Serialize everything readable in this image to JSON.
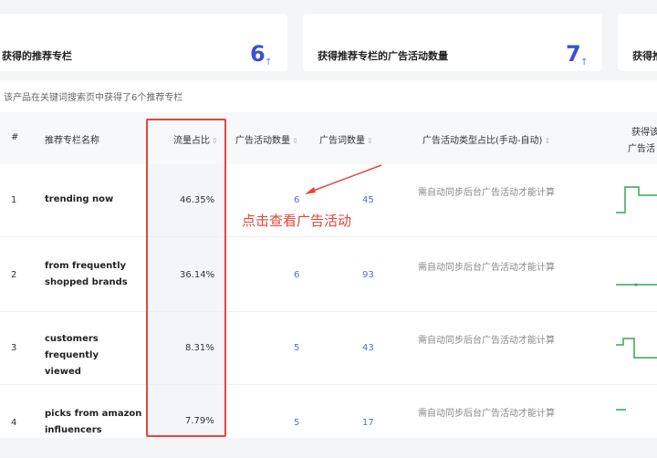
{
  "cards": [
    {
      "label": "获得的推荐专栏",
      "value": "6",
      "trend_icon": "arrow-up-icon"
    },
    {
      "label": "获得推荐专栏的广告活动数量",
      "value": "7",
      "trend_icon": "arrow-up-icon"
    },
    {
      "label": "获得推"
    }
  ],
  "subtitle": "该产品在关键词搜索页中获得了6个推荐专栏",
  "table": {
    "headers": {
      "index": "#",
      "name": "推荐专栏名称",
      "traffic": "流量占比",
      "campaigns": "广告活动数量",
      "keywords": "广告词数量",
      "type": "广告活动类型占比(手动-自动)",
      "last1": "获得该",
      "last2": "广告活"
    },
    "rows": [
      {
        "index": "1",
        "name": "trending now",
        "traffic": "46.35%",
        "campaigns": "6",
        "keywords": "45",
        "type": "需自动同步后台广告活动才能计算"
      },
      {
        "index": "2",
        "name": "from frequently shopped brands",
        "traffic": "36.14%",
        "campaigns": "6",
        "keywords": "93",
        "type": "需自动同步后台广告活动才能计算"
      },
      {
        "index": "3",
        "name": "customers frequently viewed",
        "traffic": "8.31%",
        "campaigns": "5",
        "keywords": "43",
        "type": "需自动同步后台广告活动才能计算"
      },
      {
        "index": "4",
        "name": "picks from amazon influencers",
        "traffic": "7.79%",
        "campaigns": "5",
        "keywords": "17",
        "type": "需自动同步后台广告活动才能计算"
      }
    ]
  },
  "annotation": "点击查看广告活动",
  "colors": {
    "accent": "#3d4fd6",
    "link": "#5b67d8",
    "highlight": "#e6443c",
    "spark": "#3aa35a"
  }
}
